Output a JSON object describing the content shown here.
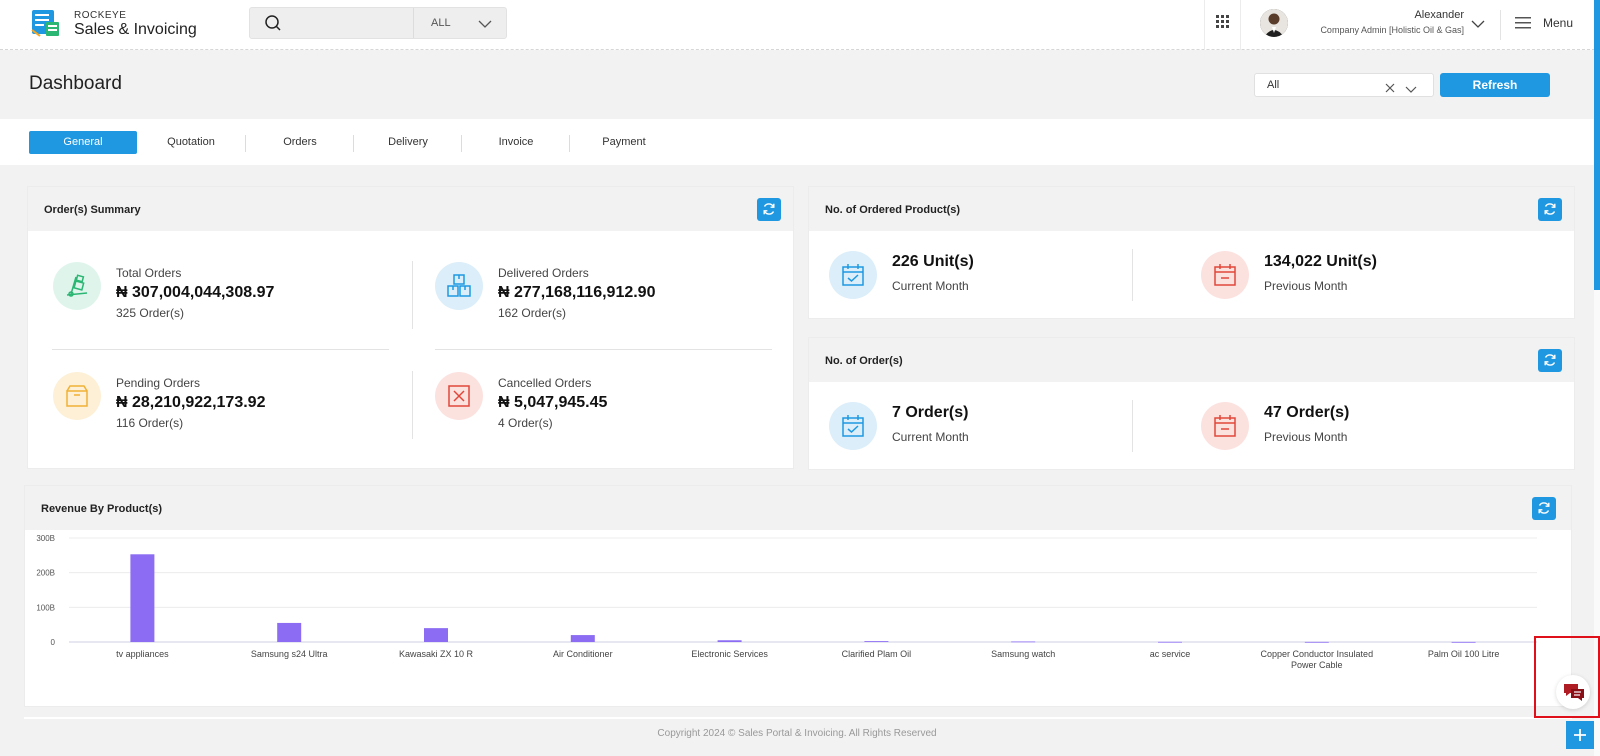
{
  "header": {
    "brand_small": "ROCKEYE",
    "brand_big": "Sales & Invoicing",
    "search_scope": "ALL",
    "user_name": "Alexander",
    "user_role": "Company Admin [Holistic Oil & Gas]",
    "menu_label": "Menu"
  },
  "page": {
    "title": "Dashboard",
    "filter_value": "All",
    "refresh_label": "Refresh"
  },
  "tabs": [
    "General",
    "Quotation",
    "Orders",
    "Delivery",
    "Invoice",
    "Payment"
  ],
  "orders_summary": {
    "title": "Order(s) Summary",
    "items": [
      {
        "label": "Total Orders",
        "value": "₦ 307,004,044,308.97",
        "sub": "325 Order(s)",
        "icon": "dolly-icon"
      },
      {
        "label": "Delivered Orders",
        "value": "₦ 277,168,116,912.90",
        "sub": "162 Order(s)",
        "icon": "boxes-icon"
      },
      {
        "label": "Pending Orders",
        "value": "₦ 28,210,922,173.92",
        "sub": "116 Order(s)",
        "icon": "package-icon"
      },
      {
        "label": "Cancelled Orders",
        "value": "₦ 5,047,945.45",
        "sub": "4 Order(s)",
        "icon": "cancel-box-icon"
      }
    ]
  },
  "ordered_products": {
    "title": "No. of Ordered Product(s)",
    "current_value": "226 Unit(s)",
    "current_label": "Current Month",
    "previous_value": "134,022 Unit(s)",
    "previous_label": "Previous Month"
  },
  "orders_count": {
    "title": "No. of Order(s)",
    "current_value": "7 Order(s)",
    "current_label": "Current Month",
    "previous_value": "47 Order(s)",
    "previous_label": "Previous Month"
  },
  "revenue_panel": {
    "title": "Revenue By Product(s)"
  },
  "chart_data": {
    "type": "bar",
    "title": "Revenue By Product(s)",
    "categories": [
      "tv appliances",
      "Samsung s24 Ultra",
      "Kawasaki ZX 10 R",
      "Air Conditioner",
      "Electronic Services",
      "Clarified Plam Oil",
      "Samsung watch",
      "ac service",
      "Copper Conductor Insulated Power Cable",
      "Palm Oil 100 Litre"
    ],
    "values": [
      253,
      55,
      40,
      20,
      5,
      2.5,
      1.5,
      0.5,
      0.3,
      0.2
    ],
    "y_ticks": [
      "0",
      "100B",
      "200B",
      "300B"
    ],
    "ylim": [
      0,
      300
    ],
    "grid": true,
    "bar_color": "#8b6cf2"
  },
  "footer": {
    "copyright": "Copyright 2024 © Sales Portal & Invoicing. All Rights Reserved"
  },
  "colors": {
    "accent": "#1f98e1",
    "bar": "#8b6cf2",
    "highlight": "#e0101a"
  }
}
